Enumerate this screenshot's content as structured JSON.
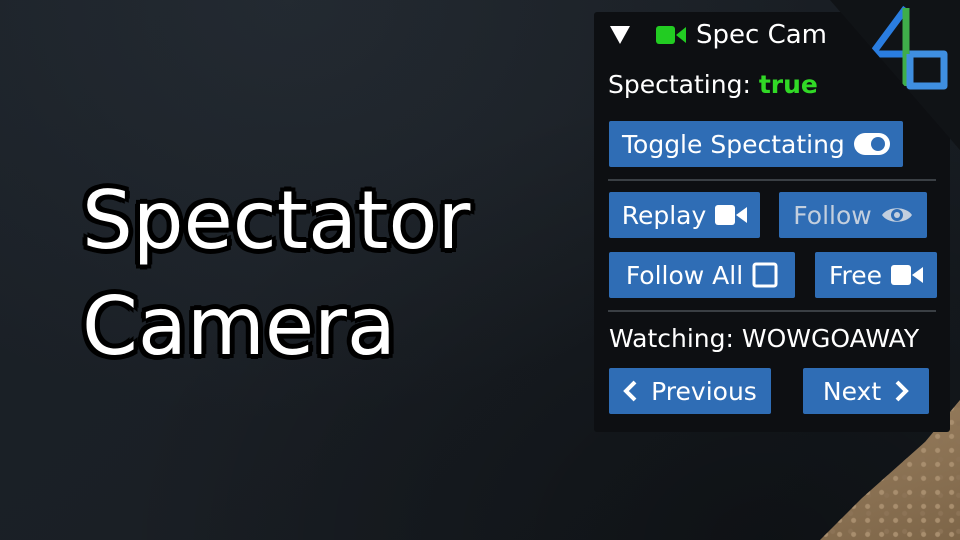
{
  "background": {
    "color": "#1a1f25",
    "accent_corner": "sand-ground"
  },
  "title": {
    "line1": "Spectator",
    "line2": "Camera"
  },
  "panel": {
    "header_title": "Spec Cam",
    "header_icons": [
      "collapse-triangle-icon",
      "video-camera-icon"
    ],
    "spectating_label": "Spectating:",
    "spectating_value": "true",
    "toggle_label": "Toggle Spectating",
    "replay_label": "Replay",
    "follow_label": "Follow",
    "follow_all_label": "Follow All",
    "free_label": "Free",
    "watching_label": "Watching: WOWGOAWAY",
    "previous_label": "Previous",
    "next_label": "Next"
  },
  "colors": {
    "button_blue": "#2f6db5",
    "status_green": "#31d926",
    "camera_green": "#22cc22",
    "panel_bg": "#0d0f12"
  },
  "logo": {
    "icon": "4b-logo-icon"
  }
}
